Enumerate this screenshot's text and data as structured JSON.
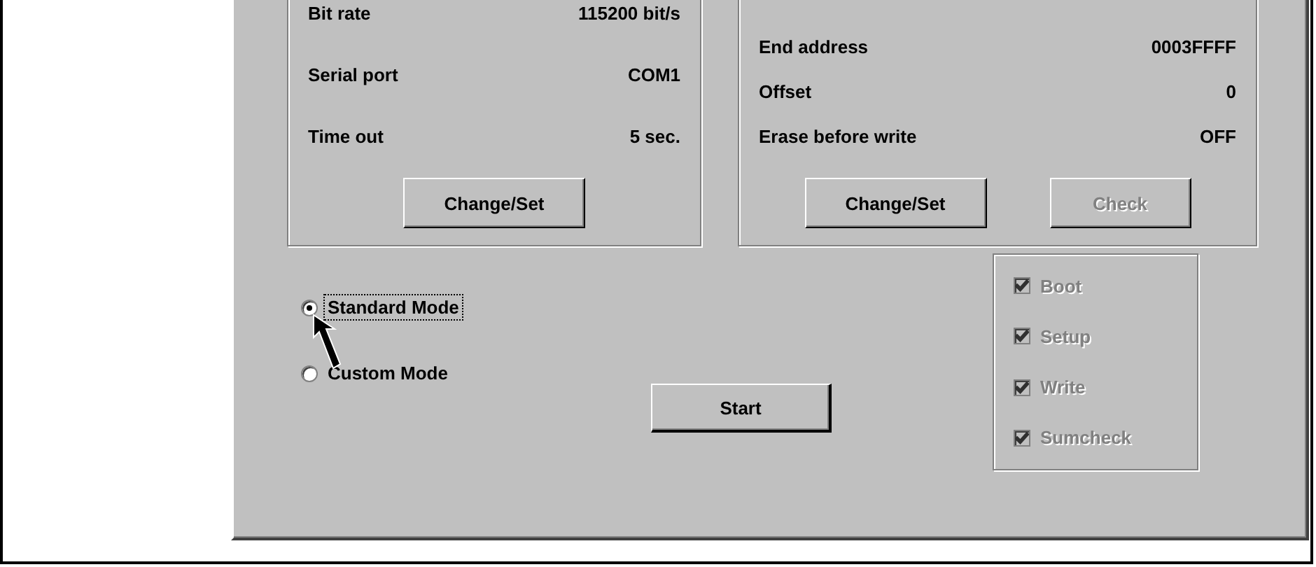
{
  "communication": {
    "rows": [
      {
        "label": "Bit rate",
        "value": "115200 bit/s"
      },
      {
        "label": "Serial port",
        "value": "COM1"
      },
      {
        "label": "Time out",
        "value": "5 sec."
      }
    ],
    "buttons": [
      {
        "label": "Change/Set",
        "disabled": false
      }
    ]
  },
  "address": {
    "rows": [
      {
        "label": "End address",
        "value": "0003FFFF"
      },
      {
        "label": "Offset",
        "value": "0"
      },
      {
        "label": "Erase before write",
        "value": "OFF"
      }
    ],
    "buttons": [
      {
        "label": "Change/Set",
        "disabled": false
      },
      {
        "label": "Check",
        "disabled": true
      }
    ]
  },
  "modes": [
    {
      "label": "Standard Mode",
      "selected": true,
      "focused": true
    },
    {
      "label": "Custom Mode",
      "selected": false,
      "focused": false
    }
  ],
  "start_button": "Start",
  "steps": {
    "disabled": true,
    "items": [
      {
        "label": "Boot",
        "checked": true
      },
      {
        "label": "Setup",
        "checked": true
      },
      {
        "label": "Write",
        "checked": true
      },
      {
        "label": "Sumcheck",
        "checked": true
      }
    ]
  }
}
